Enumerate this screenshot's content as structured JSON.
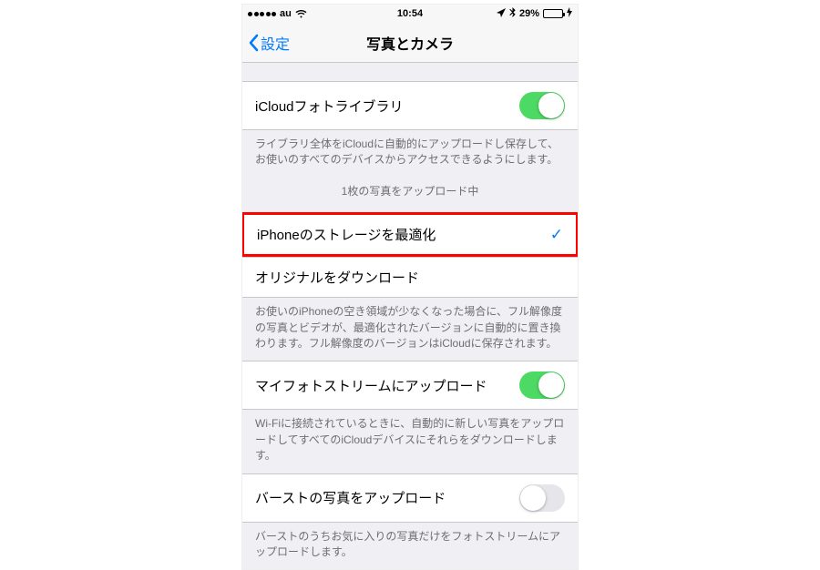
{
  "status": {
    "carrier": "au",
    "time": "10:54",
    "battery_pct": "29%"
  },
  "nav": {
    "back": "設定",
    "title": "写真とカメラ"
  },
  "rows": {
    "icloud_library": "iCloudフォトライブラリ",
    "icloud_desc": "ライブラリ全体をiCloudに自動的にアップロードし保存して、お使いのすべてのデバイスからアクセスできるようにします。",
    "upload_status": "1枚の写真をアップロード中",
    "optimize": "iPhoneのストレージを最適化",
    "download_original": "オリジナルをダウンロード",
    "optimize_desc": "お使いのiPhoneの空き領域が少なくなった場合に、フル解像度の写真とビデオが、最適化されたバージョンに自動的に置き換わります。フル解像度のバージョンはiCloudに保存されます。",
    "photostream": "マイフォトストリームにアップロード",
    "photostream_desc": "Wi-Fiに接続されているときに、自動的に新しい写真をアップロードしてすべてのiCloudデバイスにそれらをダウンロードします。",
    "burst": "バーストの写真をアップロード",
    "burst_desc": "バーストのうちお気に入りの写真だけをフォトストリームにアップロードします。"
  },
  "toggles": {
    "icloud_library": true,
    "photostream": true,
    "burst": false
  },
  "selected_option": "optimize"
}
